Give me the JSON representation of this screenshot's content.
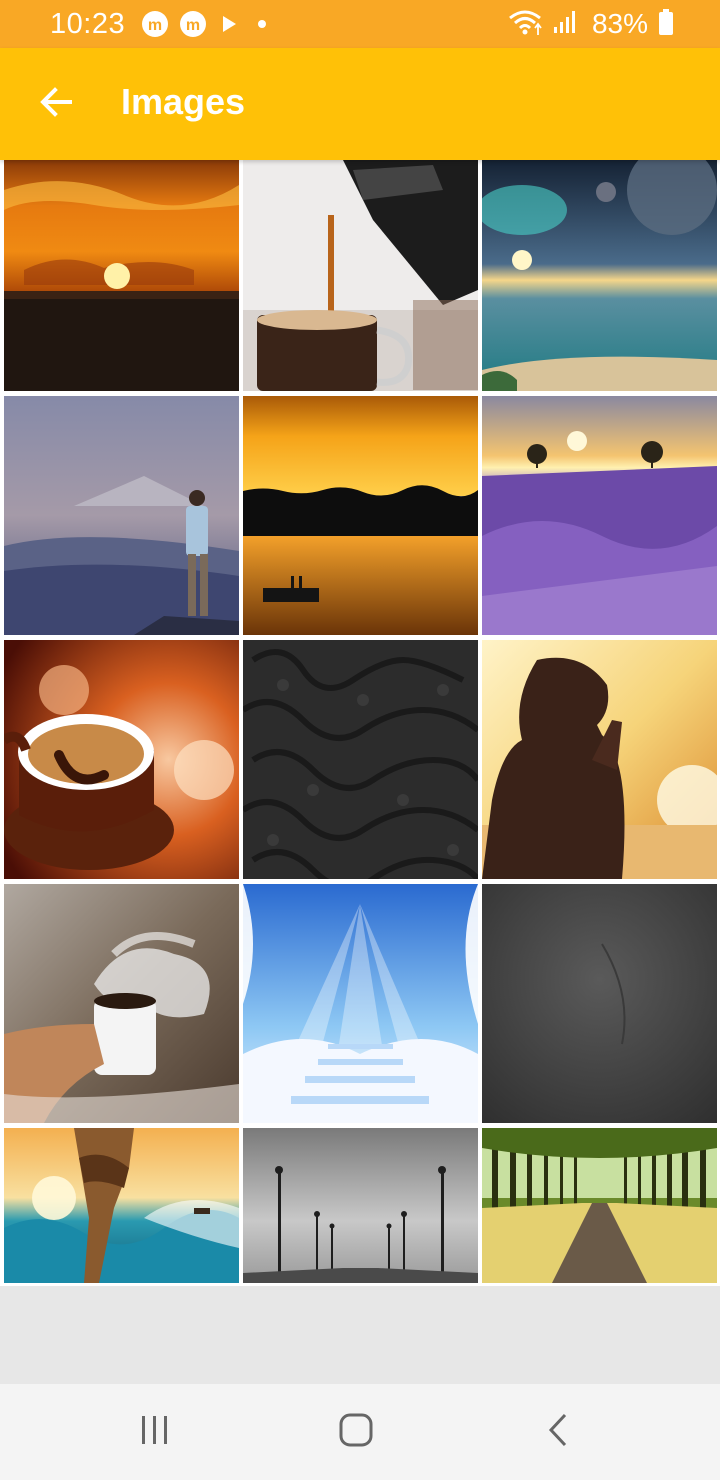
{
  "status_bar": {
    "time": "10:23",
    "battery_percent": "83%",
    "notification_icons": [
      "m-circle-icon",
      "m-circle-icon",
      "play-icon",
      "dot-icon"
    ],
    "system_icons": [
      "wifi-icon",
      "signal-icon",
      "battery-icon"
    ],
    "background_color": "#f9a825"
  },
  "app_bar": {
    "title": "Images",
    "back_icon": "arrow-back-icon",
    "background_color": "#ffc107"
  },
  "gallery": {
    "columns": 3,
    "images": [
      {
        "subject": "sunset-over-sea"
      },
      {
        "subject": "coffee-pouring"
      },
      {
        "subject": "fantasy-sea-planets"
      },
      {
        "subject": "man-on-mountain"
      },
      {
        "subject": "lake-sunset-dock"
      },
      {
        "subject": "lavender-field-sunset"
      },
      {
        "subject": "coffee-cup-smile"
      },
      {
        "subject": "dark-floral-pattern"
      },
      {
        "subject": "woman-praying-silhouette"
      },
      {
        "subject": "hand-holding-coffee-steam"
      },
      {
        "subject": "stairway-to-heaven"
      },
      {
        "subject": "gray-concrete-wall"
      },
      {
        "subject": "hand-rescue-ocean"
      },
      {
        "subject": "foggy-pier-lamps"
      },
      {
        "subject": "tree-lined-path"
      }
    ]
  },
  "nav_bar": {
    "recents_icon": "recents-icon",
    "home_icon": "home-icon",
    "back_icon": "chevron-left-icon"
  }
}
